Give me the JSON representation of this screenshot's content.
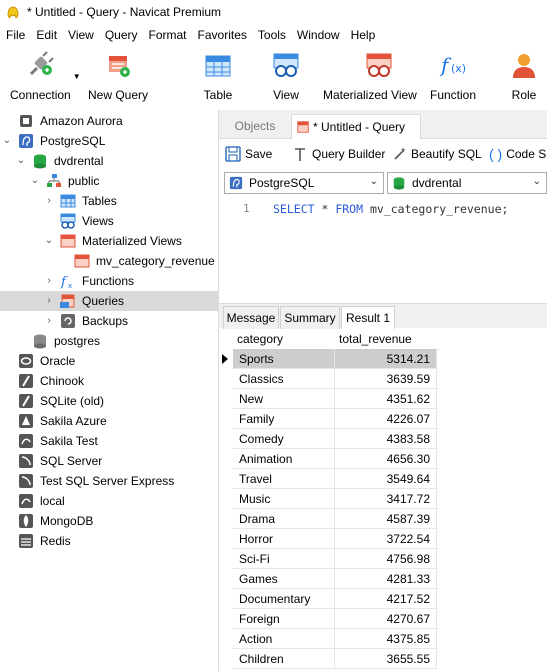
{
  "window": {
    "title": "* Untitled - Query - Navicat Premium"
  },
  "menu": [
    "File",
    "Edit",
    "View",
    "Query",
    "Format",
    "Favorites",
    "Tools",
    "Window",
    "Help"
  ],
  "toolbar": {
    "connection": "Connection",
    "new_query": "New Query",
    "table": "Table",
    "view": "View",
    "materialized_view": "Materialized View",
    "function": "Function",
    "role": "Role"
  },
  "tree": [
    {
      "label": "Amazon Aurora",
      "icon": "aurora-icon"
    },
    {
      "label": "PostgreSQL",
      "icon": "postgres-icon"
    },
    {
      "label": "dvdrental",
      "icon": "database-icon"
    },
    {
      "label": "public",
      "icon": "schema-icon"
    },
    {
      "label": "Tables",
      "icon": "table-icon"
    },
    {
      "label": "Views",
      "icon": "view-icon"
    },
    {
      "label": "Materialized Views",
      "icon": "materialized-view-icon"
    },
    {
      "label": "mv_category_revenue",
      "icon": "materialized-view-icon"
    },
    {
      "label": "Functions",
      "icon": "function-icon"
    },
    {
      "label": "Queries",
      "icon": "query-icon"
    },
    {
      "label": "Backups",
      "icon": "backup-icon"
    },
    {
      "label": "postgres",
      "icon": "database-icon"
    },
    {
      "label": "Oracle",
      "icon": "oracle-icon"
    },
    {
      "label": "Chinook",
      "icon": "sqlite-icon"
    },
    {
      "label": "SQLite (old)",
      "icon": "sqlite-icon"
    },
    {
      "label": "Sakila Azure",
      "icon": "azure-icon"
    },
    {
      "label": "Sakila Test",
      "icon": "mysql-icon"
    },
    {
      "label": "SQL Server",
      "icon": "sqlserver-icon"
    },
    {
      "label": "Test SQL Server Express",
      "icon": "sqlserver-icon"
    },
    {
      "label": "local",
      "icon": "mysql-icon"
    },
    {
      "label": "MongoDB",
      "icon": "mongodb-icon"
    },
    {
      "label": "Redis",
      "icon": "redis-icon"
    }
  ],
  "tabs": {
    "objects": "Objects",
    "query": "* Untitled - Query"
  },
  "query_toolbar": {
    "save": "Save",
    "query_builder": "Query Builder",
    "beautify": "Beautify SQL",
    "code_snippet": "Code S"
  },
  "connection_select": "PostgreSQL",
  "database_select": "dvdrental",
  "editor": {
    "line": "1",
    "keyword1": "SELECT",
    "star": " * ",
    "keyword2": "FROM",
    "rest": " mv_category_revenue;"
  },
  "result_tabs": {
    "message": "Message",
    "summary": "Summary",
    "result": "Result 1"
  },
  "grid": {
    "columns": [
      "category",
      "total_revenue"
    ],
    "rows": [
      [
        "Sports",
        "5314.21"
      ],
      [
        "Classics",
        "3639.59"
      ],
      [
        "New",
        "4351.62"
      ],
      [
        "Family",
        "4226.07"
      ],
      [
        "Comedy",
        "4383.58"
      ],
      [
        "Animation",
        "4656.30"
      ],
      [
        "Travel",
        "3549.64"
      ],
      [
        "Music",
        "3417.72"
      ],
      [
        "Drama",
        "4587.39"
      ],
      [
        "Horror",
        "3722.54"
      ],
      [
        "Sci-Fi",
        "4756.98"
      ],
      [
        "Games",
        "4281.33"
      ],
      [
        "Documentary",
        "4217.52"
      ],
      [
        "Foreign",
        "4270.67"
      ],
      [
        "Action",
        "4375.85"
      ],
      [
        "Children",
        "3655.55"
      ]
    ]
  }
}
